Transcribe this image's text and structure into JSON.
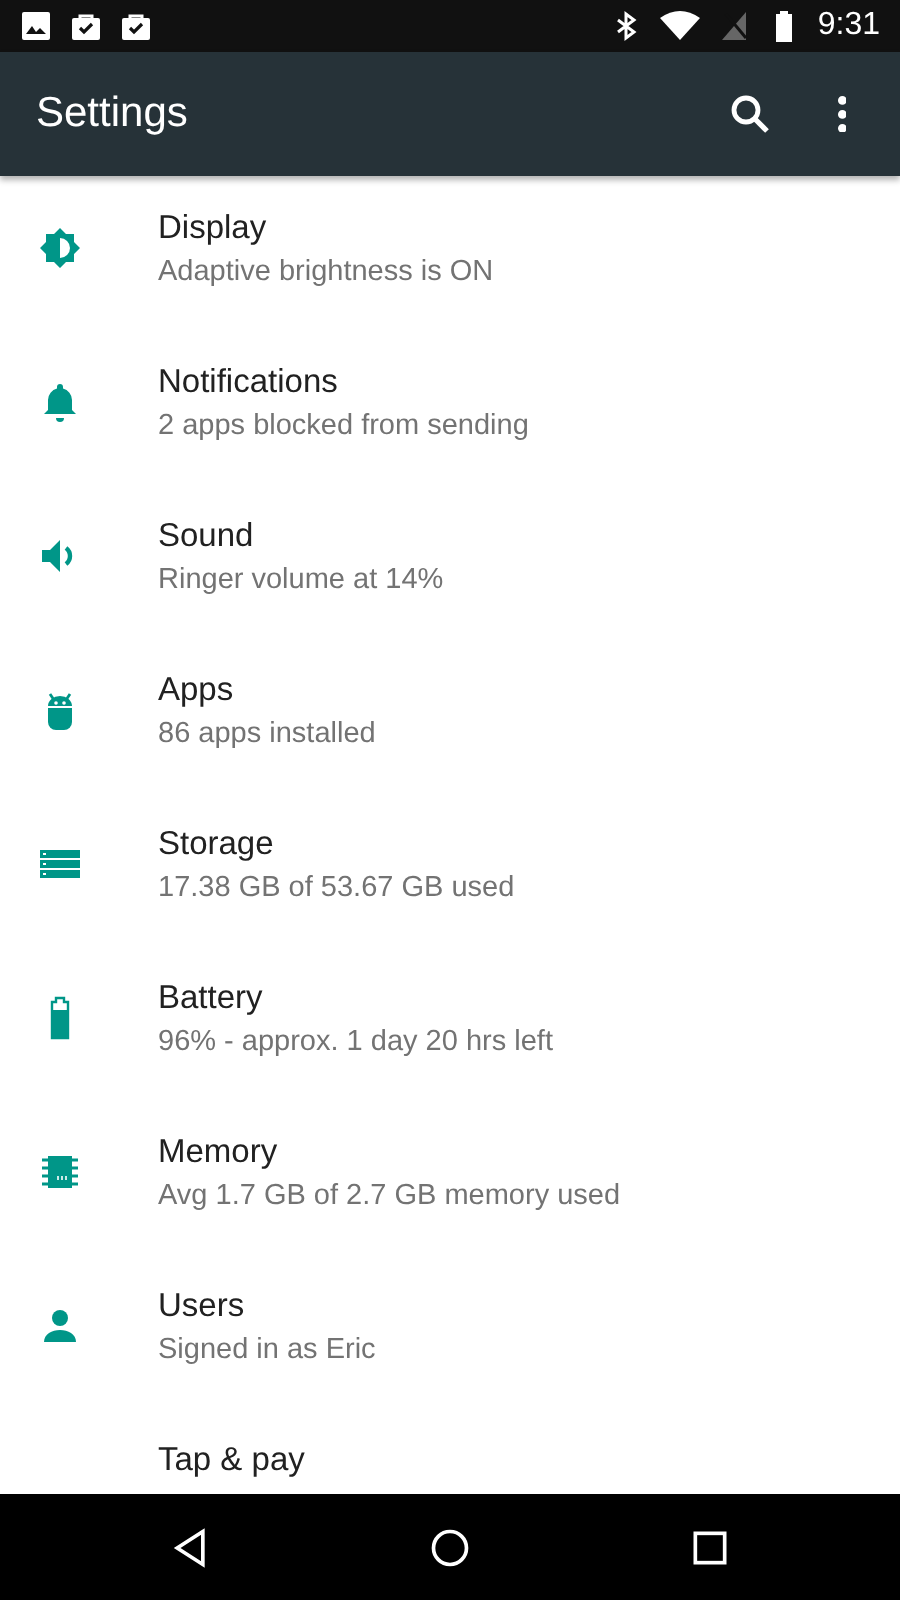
{
  "status_bar": {
    "time": "9:31"
  },
  "app_bar": {
    "title": "Settings"
  },
  "items": [
    {
      "kind": "display",
      "title": "Display",
      "subtitle": "Adaptive brightness is ON"
    },
    {
      "kind": "notifications",
      "title": "Notifications",
      "subtitle": "2 apps blocked from sending"
    },
    {
      "kind": "sound",
      "title": "Sound",
      "subtitle": "Ringer volume at 14%"
    },
    {
      "kind": "apps",
      "title": "Apps",
      "subtitle": "86 apps installed"
    },
    {
      "kind": "storage",
      "title": "Storage",
      "subtitle": "17.38 GB of 53.67 GB used"
    },
    {
      "kind": "battery",
      "title": "Battery",
      "subtitle": "96% - approx. 1 day 20 hrs left"
    },
    {
      "kind": "memory",
      "title": "Memory",
      "subtitle": "Avg 1.7 GB of 2.7 GB memory used"
    },
    {
      "kind": "users",
      "title": "Users",
      "subtitle": "Signed in as Eric"
    },
    {
      "kind": "pay",
      "title": "Tap & pay"
    }
  ]
}
